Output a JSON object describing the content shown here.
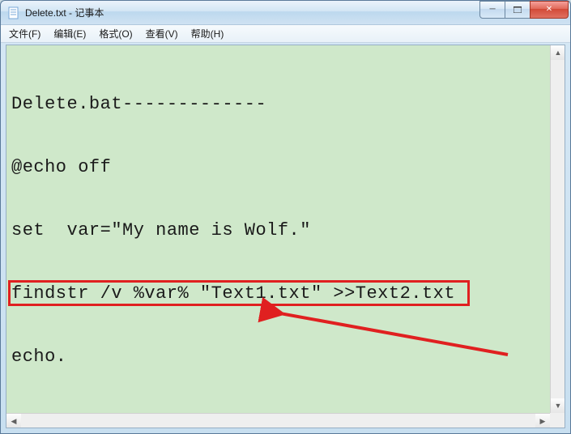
{
  "window": {
    "title": "Delete.txt - 记事本"
  },
  "controls": {
    "minimize": "─",
    "maximize": "□",
    "close": "✕"
  },
  "menu": {
    "file": "文件(F)",
    "edit": "编辑(E)",
    "format": "格式(O)",
    "view": "查看(V)",
    "help": "帮助(H)"
  },
  "content": {
    "lines": [
      "Delete.bat-------------",
      "@echo off",
      "set  var=\"My name is Wolf.\"",
      "findstr /v %var% \"Text1.txt\" >>Text2.txt",
      "echo."
    ]
  },
  "annotation": {
    "highlight_line_index": 3,
    "box_color": "#e02020",
    "arrow_color": "#e02020"
  }
}
